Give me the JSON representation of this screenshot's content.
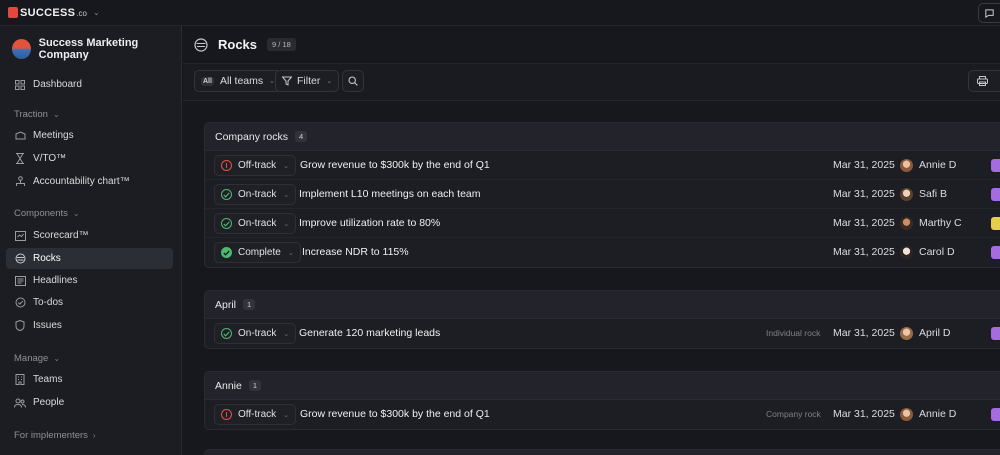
{
  "topbar": {
    "logo_text": "SUCCESS",
    "logo_suffix": ".co"
  },
  "sidebar": {
    "org_name": "Success Marketing Company",
    "dashboard": "Dashboard",
    "sections": {
      "traction": "Traction",
      "components": "Components",
      "manage": "Manage",
      "implementers": "For implementers"
    },
    "items": {
      "meetings": "Meetings",
      "vto": "V/TO™",
      "accountability": "Accountability chart™",
      "scorecard": "Scorecard™",
      "rocks": "Rocks",
      "headlines": "Headlines",
      "todos": "To-dos",
      "issues": "Issues",
      "teams": "Teams",
      "people": "People"
    }
  },
  "page": {
    "title": "Rocks",
    "count": "9 / 18"
  },
  "toolbar": {
    "teams_tag": "All",
    "teams_label": "All teams",
    "filter_label": "Filter"
  },
  "groups": [
    {
      "title": "Company rocks",
      "count": "4",
      "rows": [
        {
          "status": "Off-track",
          "title": "Grow revenue to $300k by the end of Q1",
          "kind": "",
          "date": "Mar 31, 2025",
          "owner": "Annie D"
        },
        {
          "status": "On-track",
          "title": "Implement L10 meetings on each team",
          "kind": "",
          "date": "Mar 31, 2025",
          "owner": "Safi B"
        },
        {
          "status": "On-track",
          "title": "Improve utilization rate to 80%",
          "kind": "",
          "date": "Mar 31, 2025",
          "owner": "Marthy C"
        },
        {
          "status": "Complete",
          "title": "Increase NDR to 115%",
          "kind": "",
          "date": "Mar 31, 2025",
          "owner": "Carol D"
        }
      ]
    },
    {
      "title": "April",
      "count": "1",
      "rows": [
        {
          "status": "On-track",
          "title": "Generate 120 marketing leads",
          "kind": "Individual rock",
          "date": "Mar 31, 2025",
          "owner": "April D"
        }
      ]
    },
    {
      "title": "Annie",
      "count": "1",
      "rows": [
        {
          "status": "Off-track",
          "title": "Grow revenue to $300k by the end of Q1",
          "kind": "Company rock",
          "date": "Mar 31, 2025",
          "owner": "Annie D"
        }
      ]
    }
  ],
  "colors": {
    "off_track": "#e2524a",
    "on_track": "#4fb872",
    "complete": "#4fb872",
    "tag_purple": "#a56be0",
    "tag_yellow": "#e6d04a"
  }
}
